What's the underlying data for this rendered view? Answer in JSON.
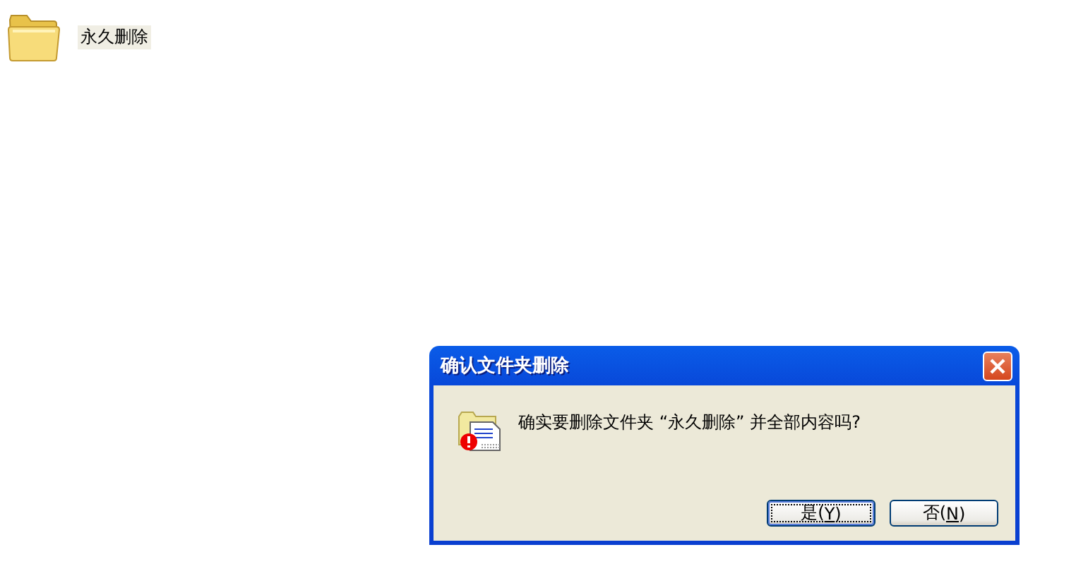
{
  "desktop_items": [
    {
      "label": "永久删除",
      "selected": true
    }
  ],
  "dialog": {
    "title": "确认文件夹删除",
    "message": "确实要删除文件夹 “永久删除” 并全部内容吗?",
    "buttons": [
      {
        "text": "是(",
        "mnemonic": "Y",
        "after": ")",
        "default": true
      },
      {
        "text": "否(",
        "mnemonic": "N",
        "after": ")",
        "default": false
      }
    ]
  }
}
